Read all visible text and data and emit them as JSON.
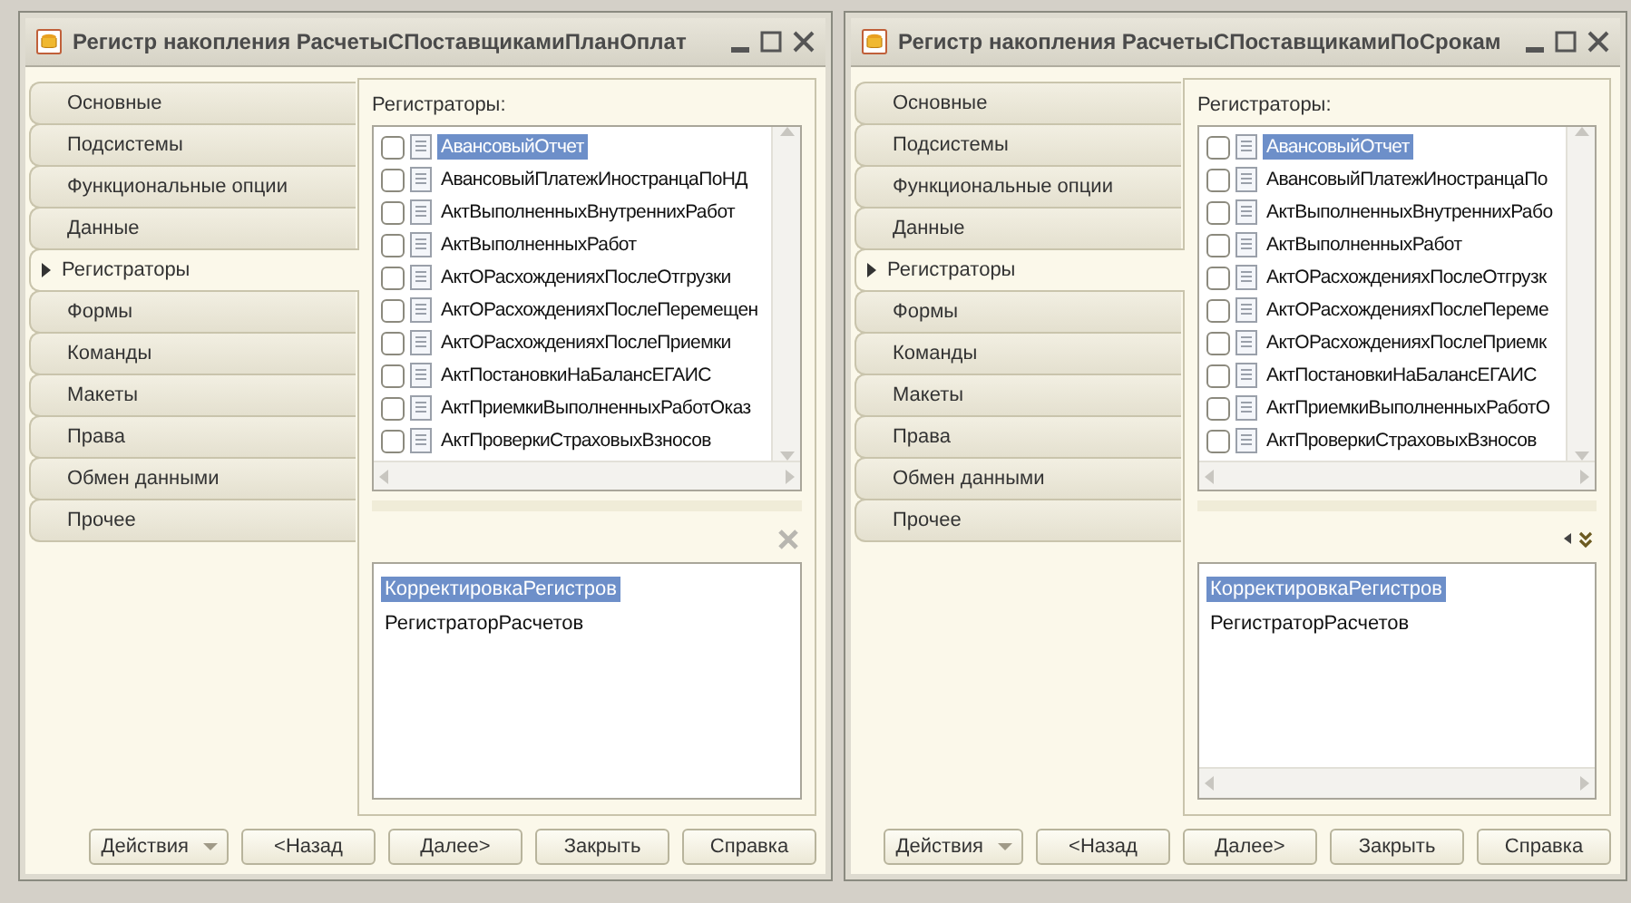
{
  "windows": [
    {
      "title": "Регистр накопления РасчетыСПоставщикамиПланОплат",
      "tabs": [
        {
          "label": "Основные",
          "selected": false
        },
        {
          "label": "Подсистемы",
          "selected": false
        },
        {
          "label": "Функциональные опции",
          "selected": false
        },
        {
          "label": "Данные",
          "selected": false
        },
        {
          "label": "Регистраторы",
          "selected": true
        },
        {
          "label": "Формы",
          "selected": false
        },
        {
          "label": "Команды",
          "selected": false
        },
        {
          "label": "Макеты",
          "selected": false
        },
        {
          "label": "Права",
          "selected": false
        },
        {
          "label": "Обмен данными",
          "selected": false
        },
        {
          "label": "Прочее",
          "selected": false
        }
      ],
      "list_label": "Регистраторы:",
      "registrators": [
        {
          "label": "АвансовыйОтчет",
          "checked": false,
          "selected": true
        },
        {
          "label": "АвансовыйПлатежИностранцаПоНД",
          "checked": false,
          "selected": false
        },
        {
          "label": "АктВыполненныхВнутреннихРабот",
          "checked": false,
          "selected": false
        },
        {
          "label": "АктВыполненныхРабот",
          "checked": false,
          "selected": false
        },
        {
          "label": "АктОРасхожденияхПослеОтгрузки",
          "checked": false,
          "selected": false
        },
        {
          "label": "АктОРасхожденияхПослеПеремещен",
          "checked": false,
          "selected": false
        },
        {
          "label": "АктОРасхожденияхПослеПриемки",
          "checked": false,
          "selected": false
        },
        {
          "label": "АктПостановкиНаБалансЕГАИС",
          "checked": false,
          "selected": false
        },
        {
          "label": "АктПриемкиВыполненныхРаботОказ",
          "checked": false,
          "selected": false
        },
        {
          "label": "АктПроверкиСтраховыхВзносов",
          "checked": false,
          "selected": false
        }
      ],
      "toolbar": [
        {
          "kind": "clear"
        }
      ],
      "selected_list": [
        {
          "label": "КорректировкаРегистров",
          "selected": true
        },
        {
          "label": "РегистраторРасчетов",
          "selected": false
        }
      ],
      "selected_list_hscroll": false,
      "buttons": [
        {
          "label": "Действия",
          "kind": "dropdown"
        },
        {
          "label": "<Назад",
          "kind": "plain"
        },
        {
          "label": "Далее>",
          "kind": "plain"
        },
        {
          "label": "Закрыть",
          "kind": "plain"
        },
        {
          "label": "Справка",
          "kind": "plain"
        }
      ]
    },
    {
      "title": "Регистр накопления РасчетыСПоставщикамиПоСрокам",
      "tabs": [
        {
          "label": "Основные",
          "selected": false
        },
        {
          "label": "Подсистемы",
          "selected": false
        },
        {
          "label": "Функциональные опции",
          "selected": false
        },
        {
          "label": "Данные",
          "selected": false
        },
        {
          "label": "Регистраторы",
          "selected": true
        },
        {
          "label": "Формы",
          "selected": false
        },
        {
          "label": "Команды",
          "selected": false
        },
        {
          "label": "Макеты",
          "selected": false
        },
        {
          "label": "Права",
          "selected": false
        },
        {
          "label": "Обмен данными",
          "selected": false
        },
        {
          "label": "Прочее",
          "selected": false
        }
      ],
      "list_label": "Регистраторы:",
      "registrators": [
        {
          "label": "АвансовыйОтчет",
          "checked": false,
          "selected": true
        },
        {
          "label": "АвансовыйПлатежИностранцаПо",
          "checked": false,
          "selected": false
        },
        {
          "label": "АктВыполненныхВнутреннихРабо",
          "checked": false,
          "selected": false
        },
        {
          "label": "АктВыполненныхРабот",
          "checked": false,
          "selected": false
        },
        {
          "label": "АктОРасхожденияхПослеОтгрузк",
          "checked": false,
          "selected": false
        },
        {
          "label": "АктОРасхожденияхПослеПереме",
          "checked": false,
          "selected": false
        },
        {
          "label": "АктОРасхожденияхПослеПриемк",
          "checked": false,
          "selected": false
        },
        {
          "label": "АктПостановкиНаБалансЕГАИС",
          "checked": false,
          "selected": false
        },
        {
          "label": "АктПриемкиВыполненныхРаботО",
          "checked": false,
          "selected": false
        },
        {
          "label": "АктПроверкиСтраховыхВзносов",
          "checked": false,
          "selected": false
        }
      ],
      "toolbar": [
        {
          "kind": "scroll-left"
        },
        {
          "kind": "expand-down"
        }
      ],
      "selected_list": [
        {
          "label": "КорректировкаРегистров",
          "selected": true
        },
        {
          "label": "РегистраторРасчетов",
          "selected": false
        }
      ],
      "selected_list_hscroll": true,
      "buttons": [
        {
          "label": "Действия",
          "kind": "dropdown"
        },
        {
          "label": "<Назад",
          "kind": "plain"
        },
        {
          "label": "Далее>",
          "kind": "plain"
        },
        {
          "label": "Закрыть",
          "kind": "plain"
        },
        {
          "label": "Справка",
          "kind": "plain"
        }
      ]
    }
  ]
}
